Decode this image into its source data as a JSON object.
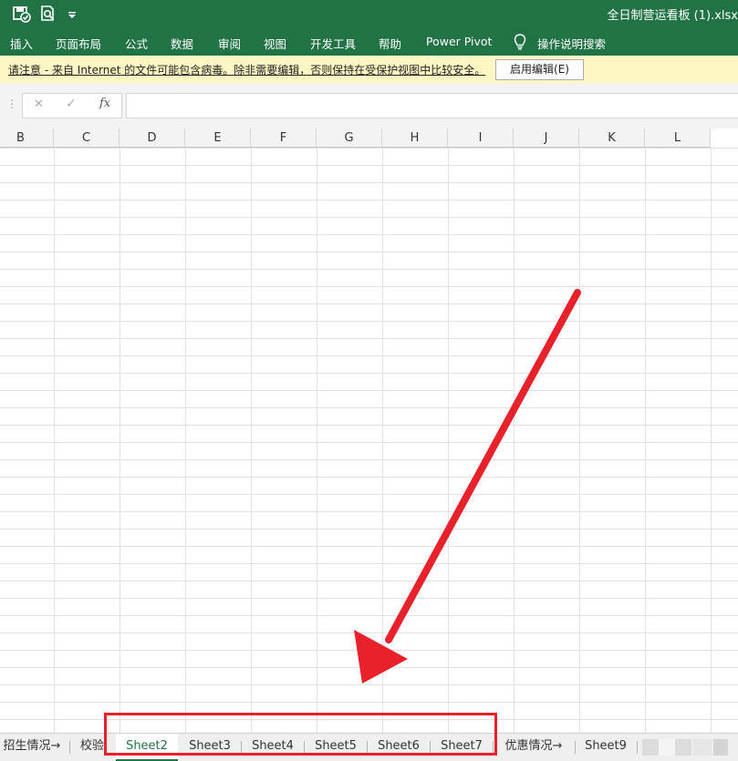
{
  "titlebar": {
    "title": "全日制营运看板 (1).xlsx",
    "bg_color": "#217346"
  },
  "ribbon": {
    "tabs": [
      "插入",
      "页面布局",
      "公式",
      "数据",
      "审阅",
      "视图",
      "开发工具",
      "帮助",
      "Power Pivot"
    ],
    "tell_me": "操作说明搜索"
  },
  "message_bar": {
    "text": "请注意 - 来自 Internet 的文件可能包含病毒。除非需要编辑，否则保持在受保护视图中比较安全。",
    "button_label": "启用编辑(E)",
    "bg_color": "#fef7c3"
  },
  "formula_bar": {
    "cancel_icon": "✕",
    "enter_icon": "✓",
    "fx_label": "fx",
    "value": ""
  },
  "columns": [
    "B",
    "C",
    "D",
    "E",
    "F",
    "G",
    "H",
    "I",
    "J",
    "K",
    "L"
  ],
  "sheet_tabs": [
    {
      "label": "招生情况→",
      "active": false
    },
    {
      "label": "校验",
      "active": false
    },
    {
      "label": "Sheet2",
      "active": true
    },
    {
      "label": "Sheet3",
      "active": false
    },
    {
      "label": "Sheet4",
      "active": false
    },
    {
      "label": "Sheet5",
      "active": false
    },
    {
      "label": "Sheet6",
      "active": false
    },
    {
      "label": "Sheet7",
      "active": false
    },
    {
      "label": "优惠情况→",
      "active": false
    },
    {
      "label": "Sheet9",
      "active": false
    }
  ],
  "annotation": {
    "color": "#e8212a",
    "shape": "arrow-pointing-to-sheet-tabs"
  }
}
